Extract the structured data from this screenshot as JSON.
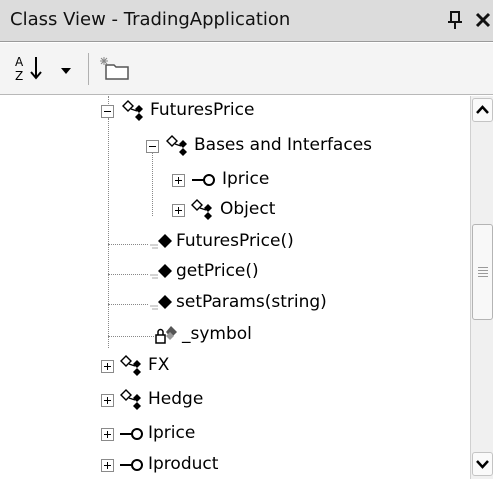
{
  "window": {
    "title": "Class View - TradingApplication",
    "pin_glyph": "q",
    "close_glyph": "✕"
  },
  "toolbar": {
    "sort_icon": "sort-alphabetical-icon",
    "dropdown_icon": "chevron-down-icon",
    "new_folder_icon": "new-folder-icon"
  },
  "tree": {
    "items": [
      {
        "label": "FuturesPrice",
        "icon": "class-icon",
        "expander": "minus"
      },
      {
        "label": "Bases and Interfaces",
        "icon": "class-icon",
        "expander": "minus"
      },
      {
        "label": "Iprice",
        "icon": "interface-icon",
        "expander": "plus"
      },
      {
        "label": "Object",
        "icon": "class-icon",
        "expander": "plus"
      },
      {
        "label": "FuturesPrice()",
        "icon": "method-icon",
        "expander": "none"
      },
      {
        "label": "getPrice()",
        "icon": "method-icon",
        "expander": "none"
      },
      {
        "label": "setParams(string)",
        "icon": "method-icon",
        "expander": "none"
      },
      {
        "label": "_symbol",
        "icon": "private-field-icon",
        "expander": "none"
      },
      {
        "label": "FX",
        "icon": "class-icon",
        "expander": "plus"
      },
      {
        "label": "Hedge",
        "icon": "class-icon",
        "expander": "plus"
      },
      {
        "label": "Iprice",
        "icon": "interface-icon",
        "expander": "plus"
      },
      {
        "label": "Iproduct",
        "icon": "interface-icon",
        "expander": "plus"
      }
    ]
  },
  "colors": {
    "titlebar": "#dcdcdc",
    "toolbar": "#f4f4f4",
    "background": "#ffffff"
  }
}
